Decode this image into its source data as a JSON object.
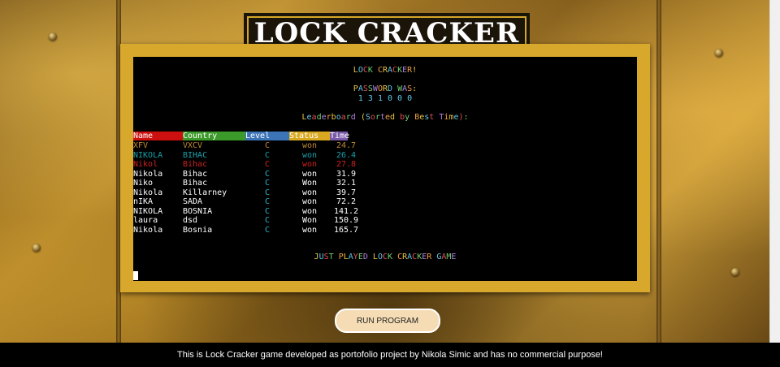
{
  "app": {
    "title": "LOCK CRACKER"
  },
  "terminal": {
    "greeting": "LOCK CRACKER!",
    "password_label": "PASSWORD WAS:",
    "password_digits": "1 3 1 0 0 0",
    "leaderboard_title": "Leaderboard (Sorted by Best Time):",
    "columns": [
      "Name",
      "Country",
      "Level",
      "Status",
      "Time"
    ],
    "rows": [
      {
        "name": "XFV",
        "country": "VXCV",
        "level": "C",
        "status": "won",
        "time": "24.7",
        "style": "hl1"
      },
      {
        "name": "NIKOLA",
        "country": "BIHAC",
        "level": "C",
        "status": "won",
        "time": "26.4",
        "style": "hl2"
      },
      {
        "name": "Nikol",
        "country": "Bihac",
        "level": "C",
        "status": "won",
        "time": "27.8",
        "style": "hl3"
      },
      {
        "name": "Nikola",
        "country": "Bihac",
        "level": "C",
        "status": "won",
        "time": "31.9",
        "style": "normal"
      },
      {
        "name": "Niko",
        "country": "Bihac",
        "level": "C",
        "status": "Won",
        "time": "32.1",
        "style": "normal"
      },
      {
        "name": "Nikola",
        "country": "Killarney",
        "level": "C",
        "status": "won",
        "time": "39.7",
        "style": "normal"
      },
      {
        "name": "nIKA",
        "country": "SADA",
        "level": "C",
        "status": "won",
        "time": "72.2",
        "style": "normal"
      },
      {
        "name": "NIKOLA",
        "country": "BOSNIA",
        "level": "C",
        "status": "won",
        "time": "141.2",
        "style": "normal"
      },
      {
        "name": "laura",
        "country": "dsd",
        "level": "C",
        "status": "Won",
        "time": "150.9",
        "style": "normal"
      },
      {
        "name": "Nikola",
        "country": "Bosnia",
        "level": "C",
        "status": "won",
        "time": "165.7",
        "style": "normal"
      }
    ],
    "closing": "JUST PLAYED LOCK CRACKER GAME"
  },
  "buttons": {
    "run_program": "RUN PROGRAM"
  },
  "footer": {
    "text": "This is Lock Cracker game developed as portofolio project by Nikola Simic and has no commercial purpose!"
  },
  "colors": {
    "frame": "#d8a82c",
    "terminal_bg": "#000000",
    "button_bg": "#f5dcb4",
    "header_name": "#cc1010",
    "header_country": "#3c9a2a",
    "header_level": "#3c74b8",
    "header_status": "#d8a820",
    "header_time": "#7a5aa8"
  }
}
